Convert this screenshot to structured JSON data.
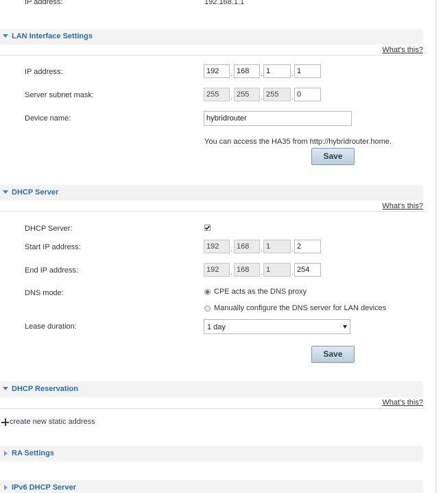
{
  "top": {
    "ip_label": "IP address:",
    "ip_value": "192.168.1.1"
  },
  "lan": {
    "title": "LAN Interface Settings",
    "whats_this": "What's this?",
    "ip_label": "IP address:",
    "ip": [
      "192",
      "168",
      "1",
      "1"
    ],
    "mask_label": "Server subnet mask:",
    "mask": [
      "255",
      "255",
      "255",
      "0"
    ],
    "device_label": "Device name:",
    "device_name": "hybridrouter",
    "access_text": "You can access the HA35 from http://hybridrouter.home.",
    "save_label": "Save"
  },
  "dhcp": {
    "title": "DHCP Server",
    "whats_this": "What's this?",
    "server_label": "DHCP Server:",
    "server_enabled": true,
    "start_label": "Start IP address:",
    "start_ip": [
      "192",
      "168",
      "1",
      "2"
    ],
    "end_label": "End IP address:",
    "end_ip": [
      "192",
      "168",
      "1",
      "254"
    ],
    "dns_label": "DNS mode:",
    "dns_option_proxy": "CPE acts as the DNS proxy",
    "dns_option_manual": "Manually configure the DNS server for LAN devices",
    "lease_label": "Lease duration:",
    "lease_value": "1 day",
    "save_label": "Save"
  },
  "reservation": {
    "title": "DHCP Reservation",
    "whats_this": "What's this?",
    "create_link": "create new static address"
  },
  "ra": {
    "title": "RA Settings"
  },
  "ipv6": {
    "title": "IPv6 DHCP Server"
  },
  "colors": {
    "section_title": "#2b6cb0",
    "header_bg": "#f3f3f3",
    "button_bg": "#c8d6e5"
  }
}
